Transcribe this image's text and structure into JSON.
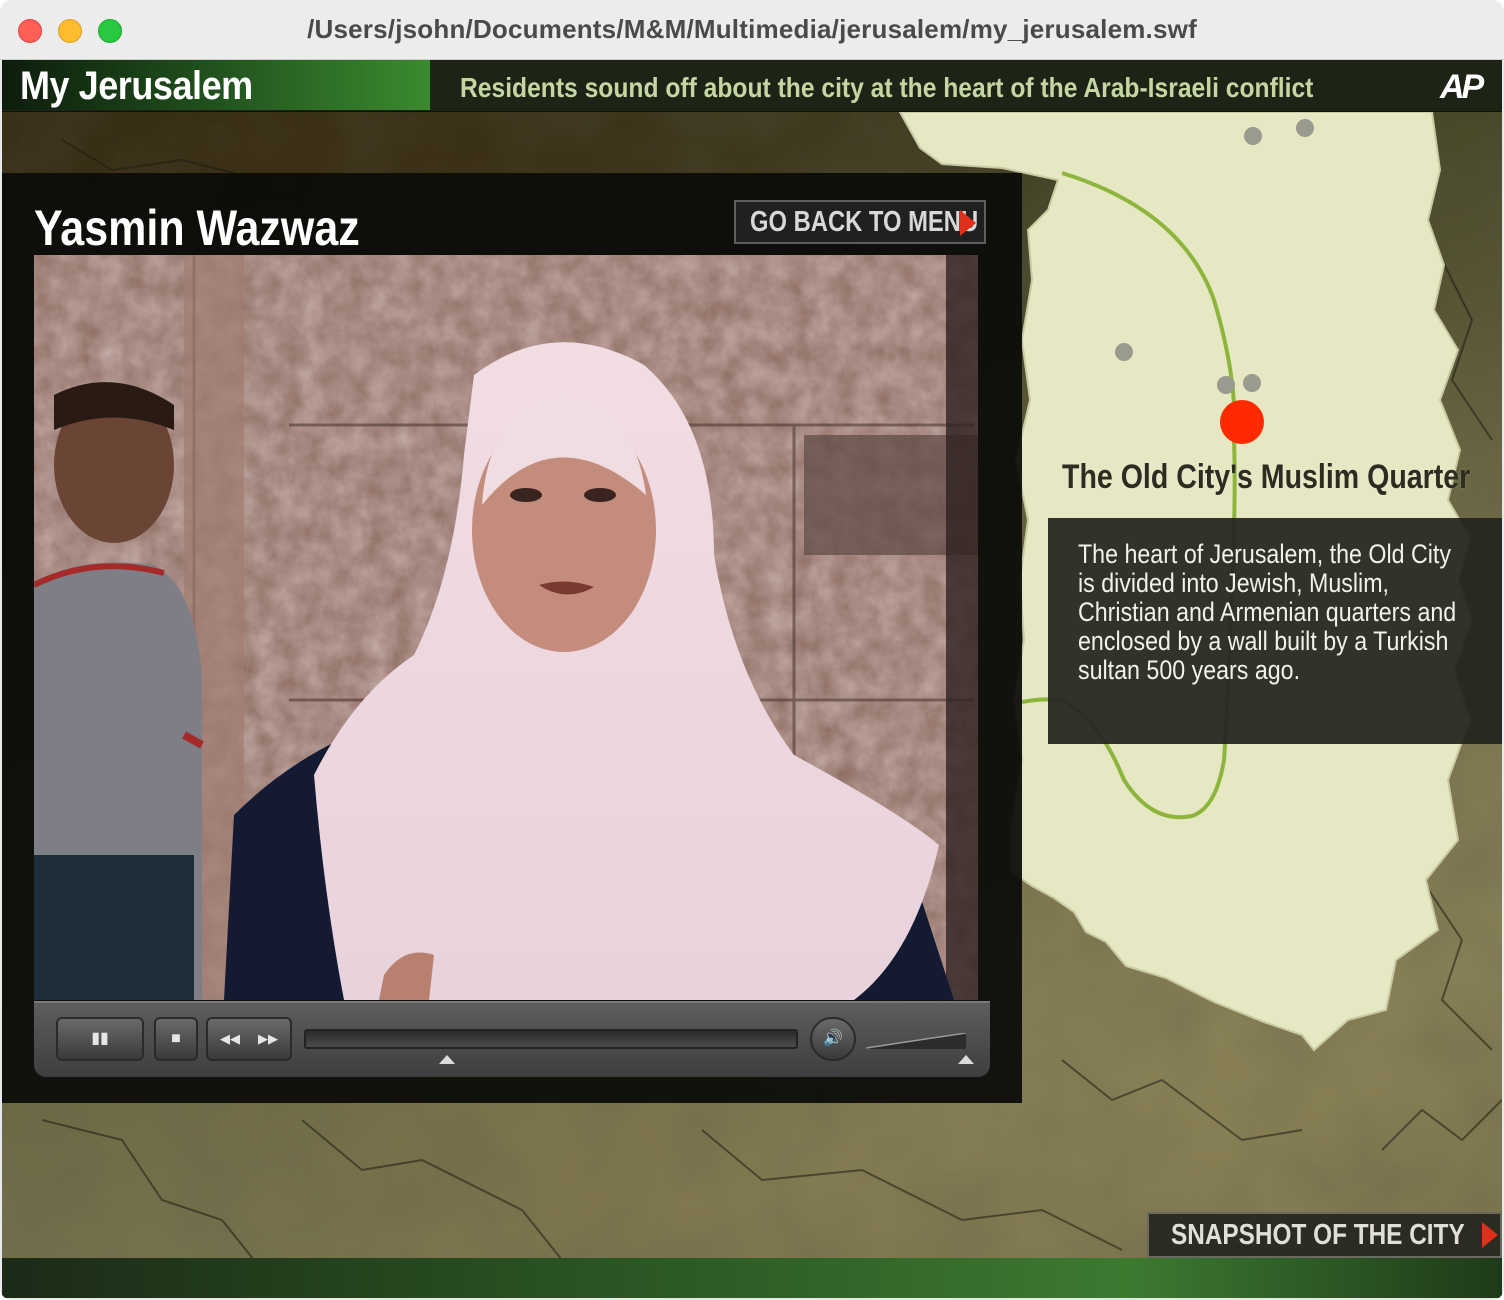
{
  "window": {
    "title": "/Users/jsohn/Documents/M&M/Multimedia/jerusalem/my_jerusalem.swf"
  },
  "header": {
    "brand": "My Jerusalem",
    "tagline": "Residents sound off about the city at the heart of the Arab-Israeli conflict",
    "logo": "AP"
  },
  "video_panel": {
    "person_name": "Yasmin Wazwaz",
    "back_button": "GO BACK TO MENU",
    "controls": {
      "pause_icon": "▮▮",
      "stop_icon": "■",
      "rewind_icon": "◀◀",
      "forward_icon": "▶▶",
      "volume_icon": "🔊",
      "progress_fraction": 0.29,
      "volume_fraction": 1.0
    }
  },
  "map": {
    "location_label": "The Old City's Muslim Quarter",
    "description": "The heart of Jerusalem, the Old City is divided into Jewish, Muslim, Christian and Armenian quarters and enclosed by a wall built by a Turkish sultan 500 years ago.",
    "marker_color": "#ff2a00",
    "route_color": "#8db53c",
    "land_color": "#e6e8c4"
  },
  "footer": {
    "snapshot_button": "SNAPSHOT OF THE CITY"
  },
  "colors": {
    "accent_green": "#3b8a2f",
    "arrow_red": "#e0301b"
  }
}
